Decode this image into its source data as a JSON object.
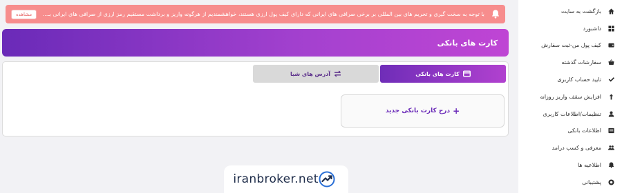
{
  "sidebar": {
    "items": [
      {
        "label": "بازگشت به سایت",
        "icon": "home-icon"
      },
      {
        "label": "داشبورد",
        "icon": "grid-icon"
      },
      {
        "label": "کیف پول من-ثبت سفارش",
        "icon": "wallet-icon"
      },
      {
        "label": "سفارشات گذشته",
        "icon": "basket-icon"
      },
      {
        "label": "تایید حساب کاربری",
        "icon": "check-icon"
      },
      {
        "label": "افزایش سقف واریز روزانه",
        "icon": "arrow-up-icon"
      },
      {
        "label": "تنظیمات/اطلاعات کاربری",
        "icon": "user-icon"
      },
      {
        "label": "اطلاعات بانکی",
        "icon": "bank-icon"
      },
      {
        "label": "معرفی و کسب درامد",
        "icon": "users-icon"
      },
      {
        "label": "اطلاعیه ها",
        "icon": "bell-icon"
      },
      {
        "label": "پشتیبانی",
        "icon": "support-icon"
      }
    ]
  },
  "notice": {
    "text": "با توجه به سخت گیری و تحریم های بین المللی بر برخی صرافی های ایرانی که دارای کیف پول ارزی هستند، خواهشمندیم از هرگونه واریز و برداشت مستقیم رمز ارزی از صرافی های ایرانی بـ...",
    "button_label": "مشاهده",
    "icon": "bell-icon"
  },
  "header": {
    "title": "کارت های بانکی"
  },
  "tabs": [
    {
      "label": "کارت های بانکی",
      "icon": "credit-card-icon",
      "active": true
    },
    {
      "label": "آدرس های شبا",
      "icon": "transfer-icon",
      "active": false
    }
  ],
  "add_card": {
    "plus": "+",
    "label": "درج کارت بانکی جدید"
  },
  "logo": {
    "text": "iranbroker.net"
  },
  "colors": {
    "accent": "#6a2ab8",
    "notice": "#f78d8d",
    "gradient_end": "#bf45d4"
  }
}
